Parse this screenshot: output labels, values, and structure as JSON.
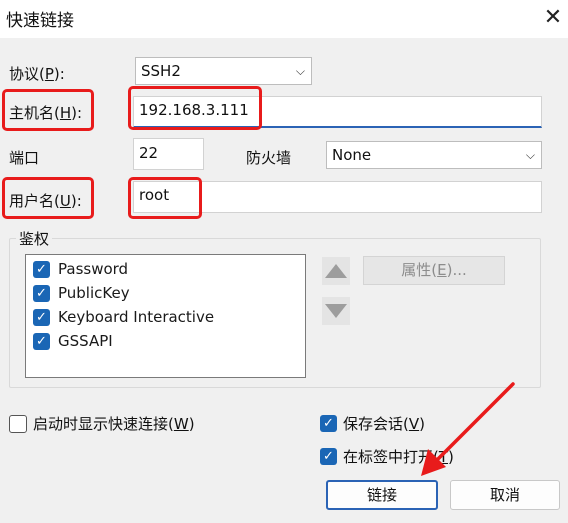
{
  "window": {
    "title": "快速链接",
    "close_glyph": "✕"
  },
  "protocol": {
    "label": "协议(",
    "key": "P",
    "tail": "):",
    "value": "SSH2"
  },
  "hostname": {
    "label": "主机名(",
    "key": "H",
    "tail": "):",
    "value": "192.168.3.111"
  },
  "port": {
    "label": "端口",
    "value": "22"
  },
  "firewall": {
    "label": "防火墙",
    "value": "None"
  },
  "username": {
    "label": "用户名(",
    "key": "U",
    "tail": "):",
    "value": "root"
  },
  "auth": {
    "group_label": "鉴权",
    "methods": [
      {
        "label": "Password",
        "checked": true
      },
      {
        "label": "PublicKey",
        "checked": true
      },
      {
        "label": "Keyboard Interactive",
        "checked": true
      },
      {
        "label": "GSSAPI",
        "checked": true
      }
    ],
    "properties_button": {
      "label": "属性(",
      "key": "E",
      "tail": ")..."
    }
  },
  "options": {
    "show_on_startup": {
      "label": "启动时显示快速连接(",
      "key": "W",
      "tail": ")",
      "checked": false
    },
    "save_session": {
      "label": "保存会话(",
      "key": "V",
      "tail": ")",
      "checked": true
    },
    "open_in_tab": {
      "label": "在标签中打开(",
      "key": "T",
      "tail": ")",
      "checked": true
    }
  },
  "buttons": {
    "connect": "链接",
    "cancel": "取消"
  },
  "icons": {
    "chevron": "chevron-down-icon",
    "check": "check-icon"
  },
  "colors": {
    "highlight": "#e81b1b",
    "accent": "#1a66b5",
    "arrow": "#e81b1b"
  }
}
